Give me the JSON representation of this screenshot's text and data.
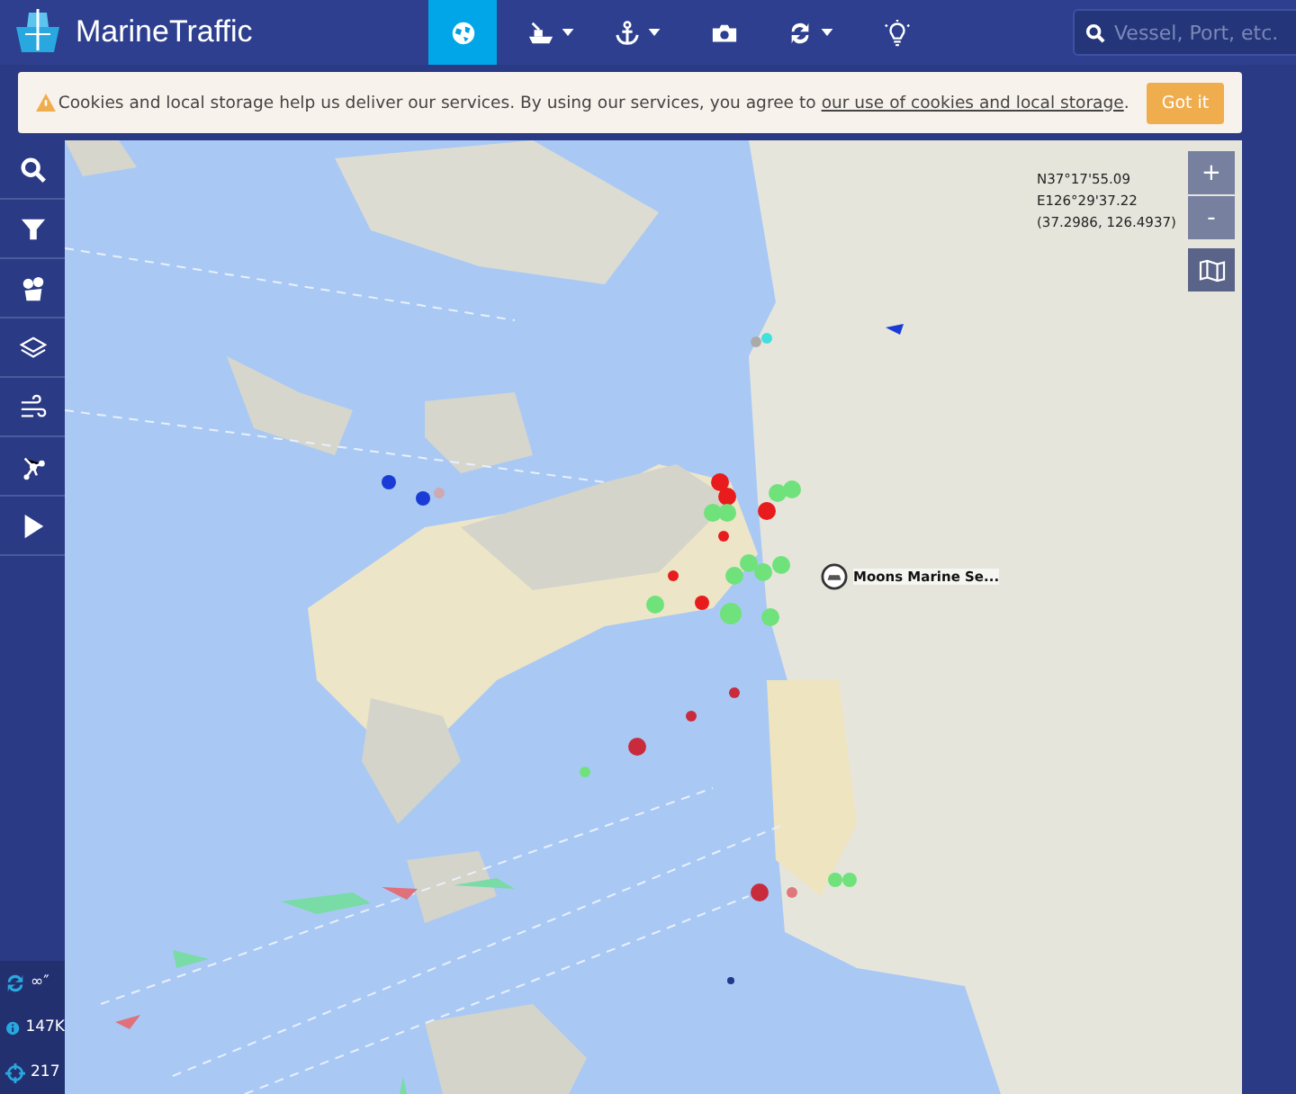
{
  "header": {
    "logo": "MarineTraffic",
    "nav": [
      {
        "selected": true,
        "dropdown": false
      },
      {
        "selected": false,
        "dropdown": true
      },
      {
        "selected": false,
        "dropdown": true
      },
      {
        "selected": false,
        "dropdown": false
      },
      {
        "selected": false,
        "dropdown": true
      },
      {
        "selected": false,
        "dropdown": false
      }
    ],
    "search": {
      "placeholder": "Vessel, Port, etc."
    }
  },
  "cookie_banner": {
    "text": "Cookies and local storage help us deliver our services. By using our services, you agree to",
    "link": "our use of cookies and local storage",
    "end": ".",
    "button": "Got it"
  },
  "sidebar": {
    "stats": [
      {
        "value": "∞″"
      },
      {
        "value": "147K"
      },
      {
        "value": "217"
      }
    ]
  },
  "map": {
    "coordinates": [
      "N37°17'55.09",
      "E126°29'37.22",
      "(37.2986, 126.4937)"
    ],
    "port_label": "Moons Marine Se...",
    "zoom": [
      "+",
      "-"
    ]
  }
}
